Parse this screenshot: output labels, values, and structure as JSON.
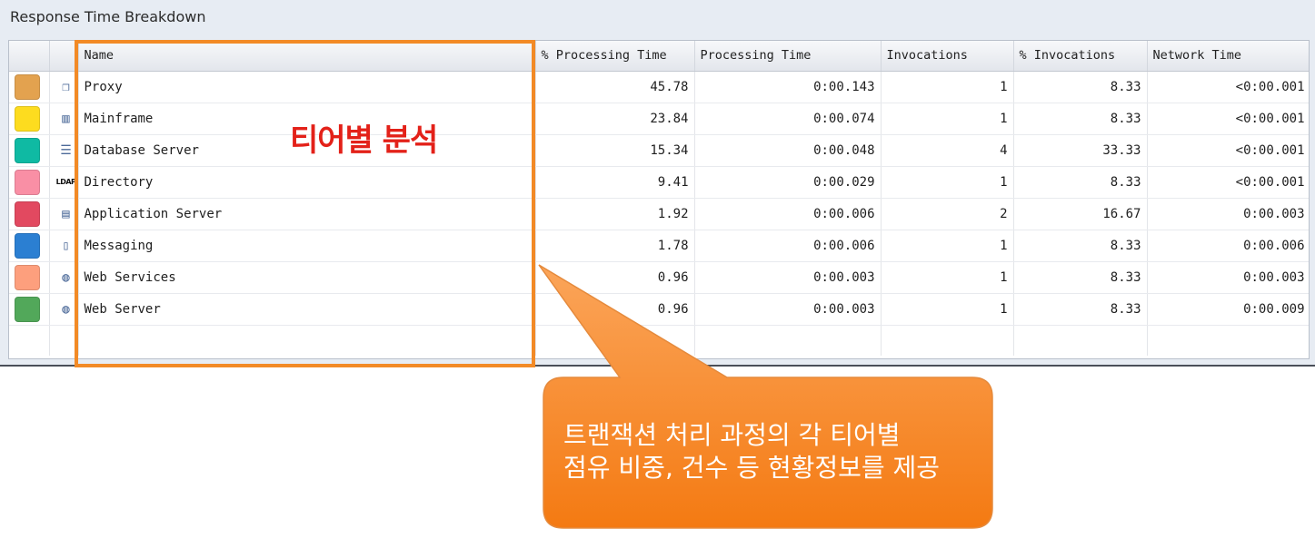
{
  "panel": {
    "title": "Response Time Breakdown"
  },
  "table": {
    "columns": [
      "",
      "",
      "Name",
      "% Processing Time",
      "Processing Time",
      "Invocations",
      "% Invocations",
      "Network Time"
    ],
    "rows": [
      {
        "color": "#e3a24f",
        "icon": "proxy-icon",
        "glyph": "❐",
        "name": "Proxy",
        "pct_processing": "45.78",
        "processing": "0:00.143",
        "invocations": "1",
        "pct_invocations": "8.33",
        "network": "<0:00.001"
      },
      {
        "color": "#fddc1f",
        "icon": "mainframe-icon",
        "glyph": "▥",
        "name": "Mainframe",
        "pct_processing": "23.84",
        "processing": "0:00.074",
        "invocations": "1",
        "pct_invocations": "8.33",
        "network": "<0:00.001"
      },
      {
        "color": "#0fbaa3",
        "icon": "database-icon",
        "glyph": "☰",
        "name": "Database Server",
        "pct_processing": "15.34",
        "processing": "0:00.048",
        "invocations": "4",
        "pct_invocations": "33.33",
        "network": "<0:00.001"
      },
      {
        "color": "#f98fa5",
        "icon": "ldap-icon",
        "glyph": "LDAP",
        "name": "Directory",
        "pct_processing": "9.41",
        "processing": "0:00.029",
        "invocations": "1",
        "pct_invocations": "8.33",
        "network": "<0:00.001"
      },
      {
        "color": "#e24960",
        "icon": "application-server-icon",
        "glyph": "▤",
        "name": "Application Server",
        "pct_processing": "1.92",
        "processing": "0:00.006",
        "invocations": "2",
        "pct_invocations": "16.67",
        "network": "0:00.003"
      },
      {
        "color": "#2b7fd2",
        "icon": "messaging-icon",
        "glyph": "▯",
        "name": "Messaging",
        "pct_processing": "1.78",
        "processing": "0:00.006",
        "invocations": "1",
        "pct_invocations": "8.33",
        "network": "0:00.006"
      },
      {
        "color": "#fd9f7d",
        "icon": "web-services-icon",
        "glyph": "◍",
        "name": "Web Services",
        "pct_processing": "0.96",
        "processing": "0:00.003",
        "invocations": "1",
        "pct_invocations": "8.33",
        "network": "0:00.003"
      },
      {
        "color": "#52a85a",
        "icon": "web-server-icon",
        "glyph": "◍",
        "name": "Web Server",
        "pct_processing": "0.96",
        "processing": "0:00.003",
        "invocations": "1",
        "pct_invocations": "8.33",
        "network": "0:00.009"
      }
    ]
  },
  "annotations": {
    "tier_label": "티어별 분석",
    "callout_line1": "트랜잭션 처리 과정의 각 티어별",
    "callout_line2": "점유 비중, 건수 등 현황정보를 제공",
    "highlight_color": "#f28a26",
    "callout_color": "#f7811d"
  }
}
